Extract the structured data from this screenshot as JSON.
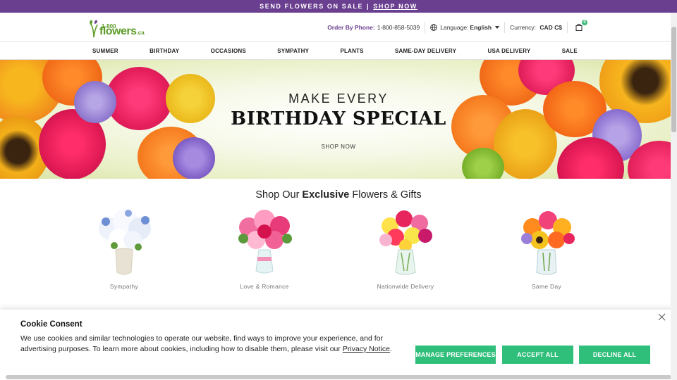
{
  "promo": {
    "text": "SEND FLOWERS ON SALE",
    "separator": "|",
    "link": "SHOP NOW",
    "bg": "#6b3f90"
  },
  "logo": {
    "top": "1-800",
    "word": "flowers",
    "suffix": ".ca"
  },
  "header": {
    "phone_label": "Order By Phone:",
    "phone": "1-800-858-5039",
    "language_label": "Language:",
    "language": "English",
    "currency_label": "Currency:",
    "currency": "CAD C$",
    "cart_count": "0"
  },
  "nav": [
    "SUMMER",
    "BIRTHDAY",
    "OCCASIONS",
    "SYMPATHY",
    "PLANTS",
    "SAME-DAY DELIVERY",
    "USA DELIVERY",
    "SALE"
  ],
  "hero": {
    "line1": "MAKE EVERY",
    "line2": "BIRTHDAY SPECIAL",
    "cta": "SHOP NOW"
  },
  "shop": {
    "title_pre": "Shop Our ",
    "title_bold": "Exclusive",
    "title_post": " Flowers & Gifts",
    "categories": [
      {
        "label": "Sympathy"
      },
      {
        "label": "Love & Romance"
      },
      {
        "label": "Nationwide Delivery"
      },
      {
        "label": "Same Day"
      }
    ]
  },
  "cookie": {
    "title": "Cookie Consent",
    "text": "We use cookies and similar technologies to operate our website, find ways to improve your experience, and for advertising purposes. To learn more about cookies, including how to disable them, please visit our ",
    "link": "Privacy Notice",
    "end": ".",
    "manage": "MANAGE PREFERENCES",
    "accept": "ACCEPT ALL",
    "decline": "DECLINE ALL",
    "button_color": "#2fbf7a"
  },
  "icons": {
    "globe": "globe-icon",
    "cart": "shopping-bag-icon",
    "close": "close-icon"
  }
}
